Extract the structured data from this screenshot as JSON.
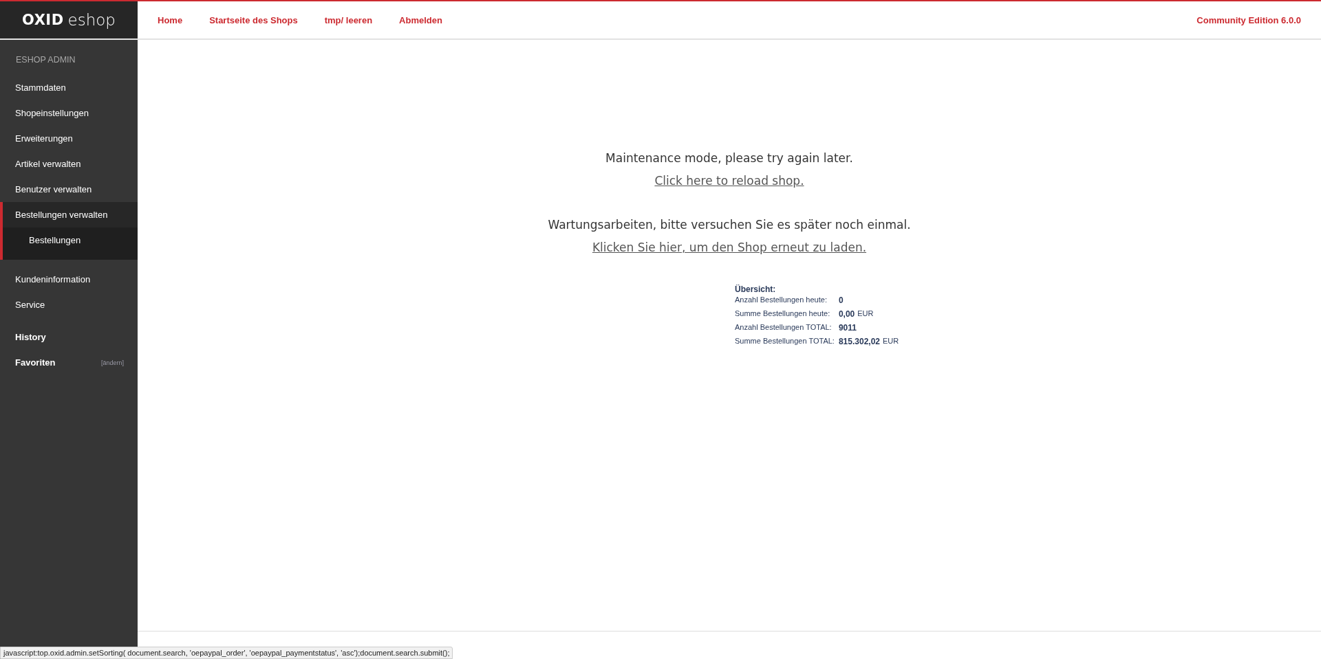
{
  "logo": {
    "word_1": "OXID",
    "word_2": "eshop"
  },
  "top_nav": {
    "links": [
      "Home",
      "Startseite des Shops",
      "tmp/ leeren",
      "Abmelden"
    ],
    "edition": "Community Edition 6.0.0"
  },
  "sidebar": {
    "heading": "ESHOP ADMIN",
    "items": [
      {
        "label": "Stammdaten",
        "expanded": false
      },
      {
        "label": "Shopeinstellungen",
        "expanded": false
      },
      {
        "label": "Erweiterungen",
        "expanded": false
      },
      {
        "label": "Artikel verwalten",
        "expanded": false
      },
      {
        "label": "Benutzer verwalten",
        "expanded": false
      },
      {
        "label": "Bestellungen verwalten",
        "expanded": true,
        "children": [
          {
            "label": "Bestellungen"
          }
        ]
      },
      {
        "label": "Kundeninformation",
        "expanded": false
      },
      {
        "label": "Service",
        "expanded": false
      }
    ],
    "history": "History",
    "favorites": {
      "label": "Favoriten",
      "edit": "[ändern]"
    }
  },
  "messages": [
    {
      "text": "Maintenance mode, please try again later.",
      "link": "Click here to reload shop."
    },
    {
      "text": "Wartungsarbeiten, bitte versuchen Sie es später noch einmal.",
      "link": "Klicken Sie hier, um den Shop erneut zu laden."
    }
  ],
  "overview": {
    "title": "Übersicht:",
    "rows": [
      {
        "label": "Anzahl Bestellungen heute:",
        "value": "0"
      },
      {
        "label": "Summe Bestellungen heute:",
        "value": "0,00",
        "unit": "EUR"
      },
      {
        "label": "Anzahl Bestellungen TOTAL:",
        "value": "9011"
      },
      {
        "label": "Summe Bestellungen TOTAL:",
        "value": "815.302,02",
        "unit": "EUR"
      }
    ]
  },
  "status_bar": "javascript:top.oxid.admin.setSorting( document.search, 'oepaypal_order', 'oepaypal_paymentstatus', 'asc');document.search.submit();"
}
